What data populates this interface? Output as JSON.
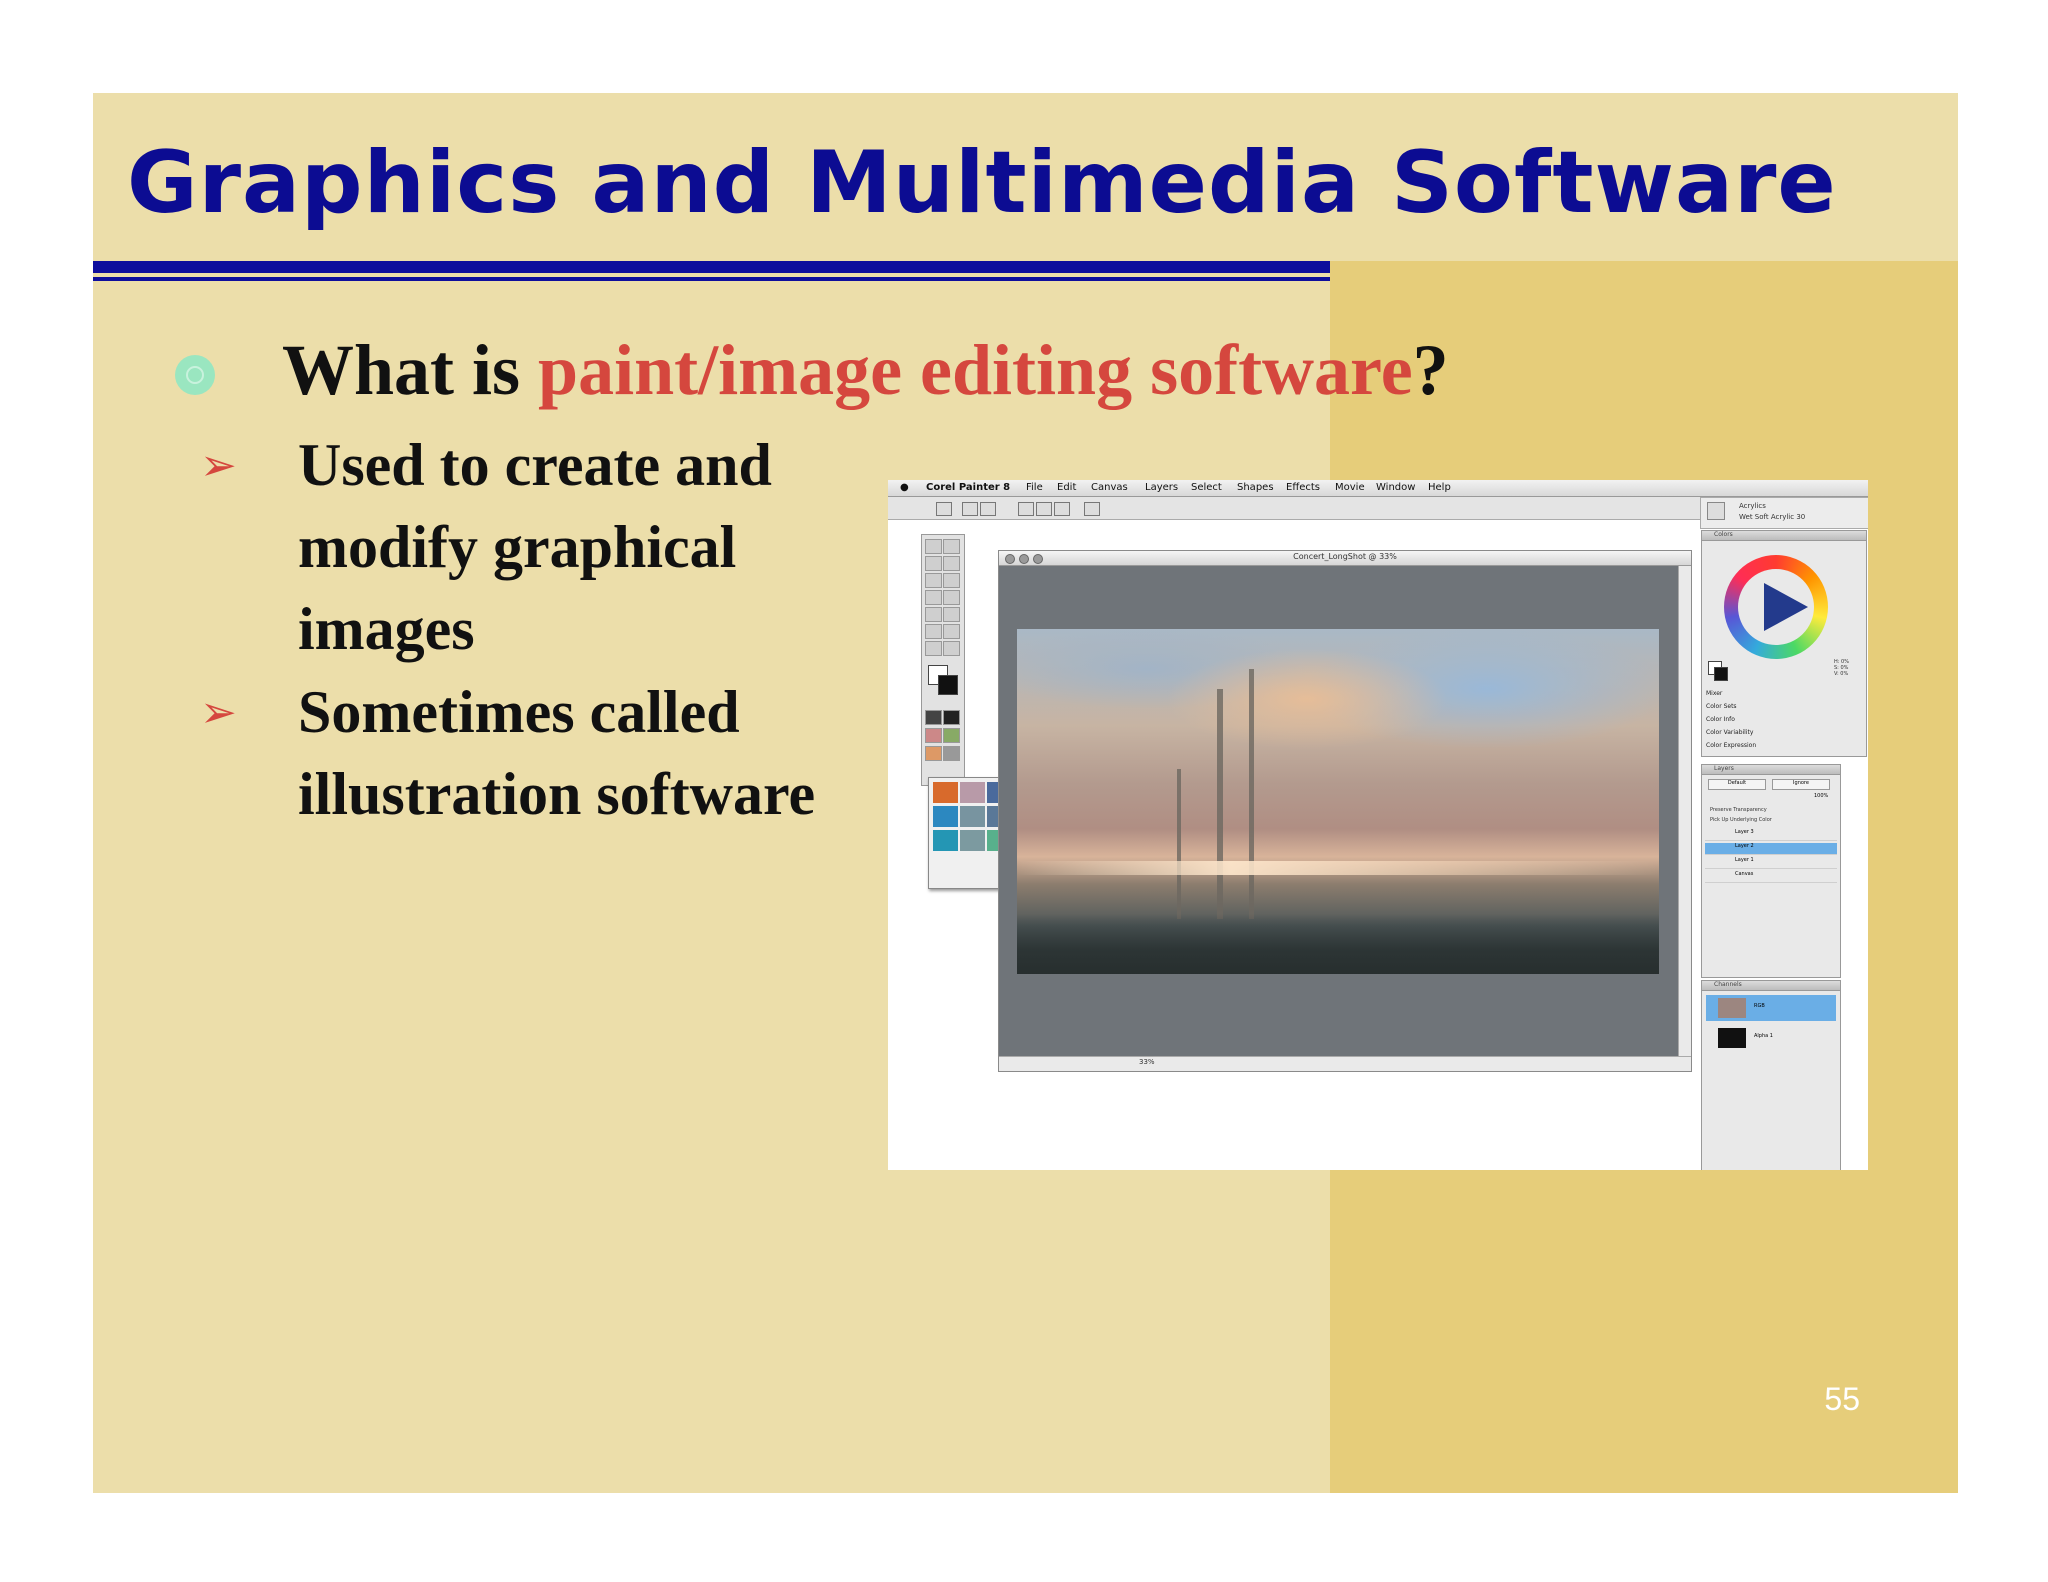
{
  "slide": {
    "title": "Graphics and Multimedia Software",
    "question_prefix": "What is ",
    "question_highlight": "paint/image editing software",
    "question_suffix": "?",
    "bullets": [
      {
        "arrow": "➢",
        "text": "Used to create and modify graphical images"
      },
      {
        "arrow": "➢",
        "text": "Sometimes called illustration software"
      }
    ],
    "page_number": "55"
  },
  "screenshot": {
    "menu": [
      "Corel Painter 8",
      "File",
      "Edit",
      "Canvas",
      "Layers",
      "Select",
      "Shapes",
      "Effects",
      "Movie",
      "Window",
      "Help"
    ],
    "brush_category": "Acrylics",
    "brush_variant": "Wet Soft Acrylic 30",
    "document_title": "Concert_LongShot @ 33%",
    "zoom": "33%",
    "colors_panel": {
      "title": "Colors",
      "hsv": [
        "H: 0%",
        "S: 0%",
        "V: 0%"
      ],
      "sections": [
        "Mixer",
        "Color Sets",
        "Color Info",
        "Color Variability",
        "Color Expression"
      ]
    },
    "layers_panel": {
      "title": "Layers",
      "composite": "Default",
      "method": "Ignore",
      "opacity": "100%",
      "options": [
        "Preserve Transparency",
        "Pick Up Underlying Color"
      ],
      "layers": [
        "Layer 3",
        "Layer 2",
        "Layer 1",
        "Canvas"
      ]
    },
    "channels_panel": {
      "title": "Channels",
      "channels": [
        "RGB",
        "Alpha 1"
      ]
    },
    "colors": {
      "accent_blue": "#0c0c92",
      "highlight_red": "#d5473e",
      "slide_bg": "#ecdeaa",
      "band_bg": "#e6cd7a",
      "selection": "#6aaee6"
    }
  }
}
